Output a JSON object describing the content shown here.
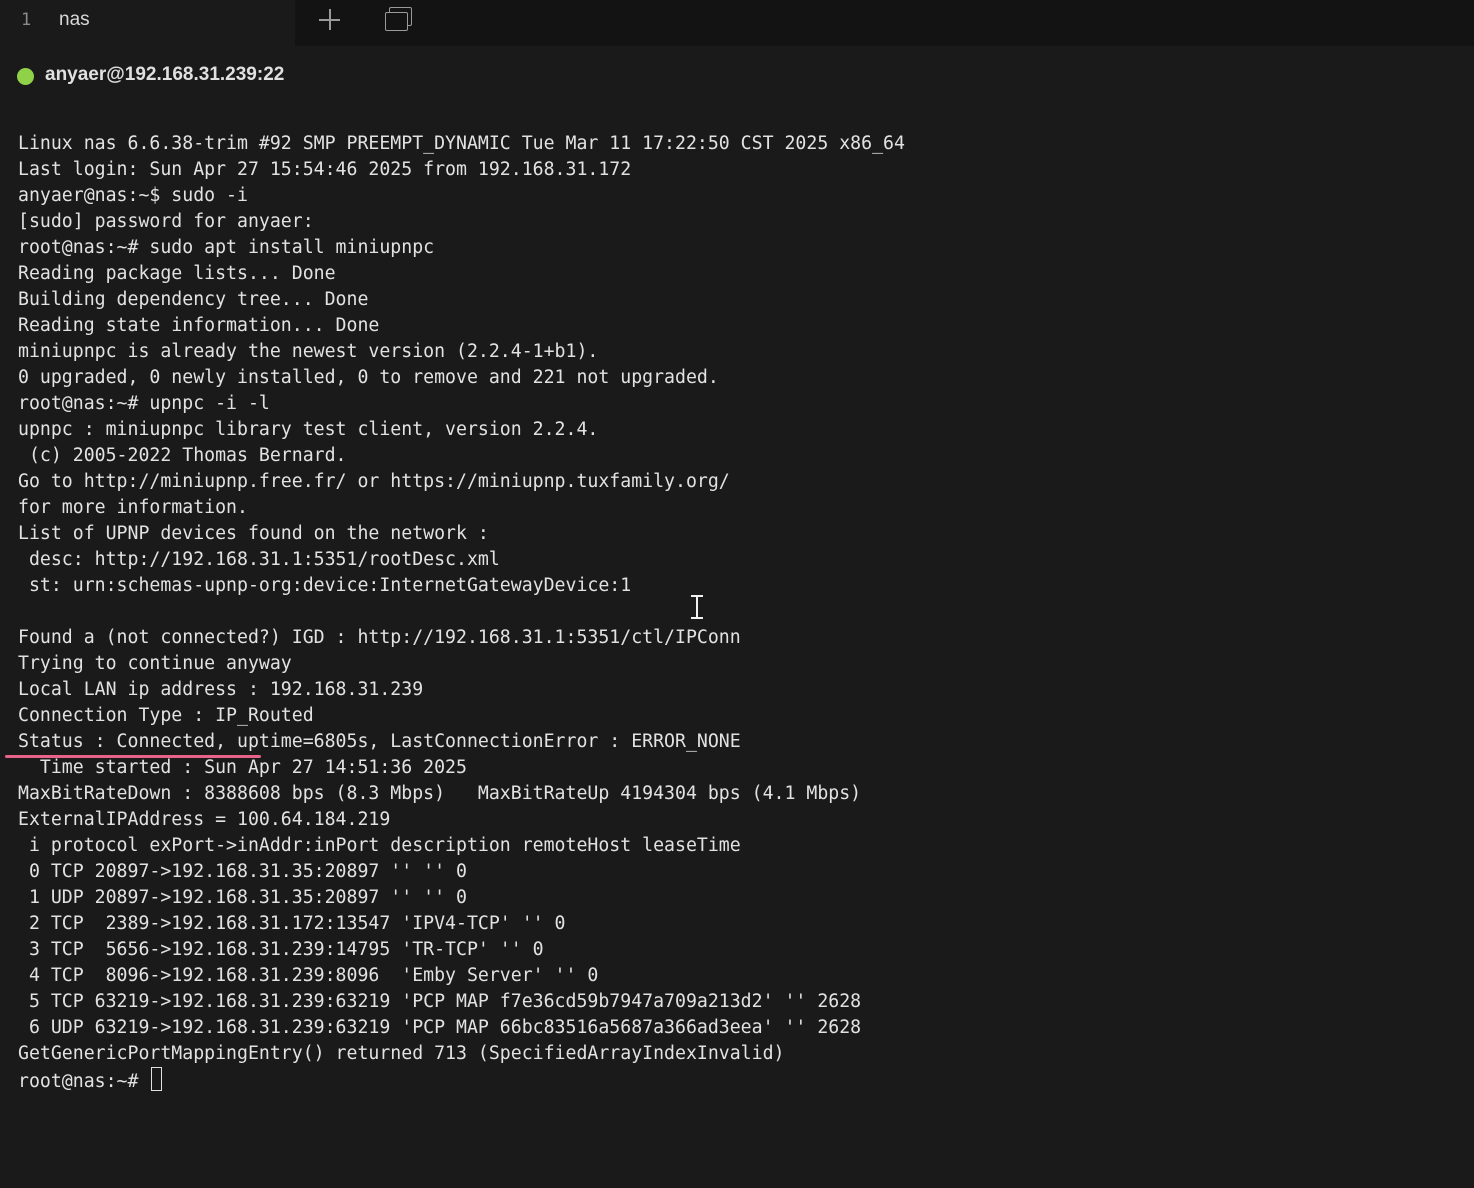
{
  "tabbar": {
    "tabs": [
      {
        "index": "1",
        "label": "nas"
      }
    ],
    "new_tab_icon": "plus-icon",
    "windows_icon": "windows-icon"
  },
  "session": {
    "status_color": "#8fd24a",
    "label": "anyaer@192.168.31.239:22"
  },
  "terminal": {
    "lines": [
      "Linux nas 6.6.38-trim #92 SMP PREEMPT_DYNAMIC Tue Mar 11 17:22:50 CST 2025 x86_64",
      "Last login: Sun Apr 27 15:54:46 2025 from 192.168.31.172",
      "anyaer@nas:~$ sudo -i",
      "[sudo] password for anyaer:",
      "root@nas:~# sudo apt install miniupnpc",
      "Reading package lists... Done",
      "Building dependency tree... Done",
      "Reading state information... Done",
      "miniupnpc is already the newest version (2.2.4-1+b1).",
      "0 upgraded, 0 newly installed, 0 to remove and 221 not upgraded.",
      "root@nas:~# upnpc -i -l",
      "upnpc : miniupnpc library test client, version 2.2.4.",
      " (c) 2005-2022 Thomas Bernard.",
      "Go to http://miniupnp.free.fr/ or https://miniupnp.tuxfamily.org/",
      "for more information.",
      "List of UPNP devices found on the network :",
      " desc: http://192.168.31.1:5351/rootDesc.xml",
      " st: urn:schemas-upnp-org:device:InternetGatewayDevice:1",
      "",
      "Found a (not connected?) IGD : http://192.168.31.1:5351/ctl/IPConn",
      "Trying to continue anyway",
      "Local LAN ip address : 192.168.31.239",
      "Connection Type : IP_Routed",
      "Status : Connected, uptime=6805s, LastConnectionError : ERROR_NONE",
      "  Time started : Sun Apr 27 14:51:36 2025",
      "MaxBitRateDown : 8388608 bps (8.3 Mbps)   MaxBitRateUp 4194304 bps (4.1 Mbps)",
      "ExternalIPAddress = 100.64.184.219",
      " i protocol exPort->inAddr:inPort description remoteHost leaseTime",
      " 0 TCP 20897->192.168.31.35:20897 '' '' 0",
      " 1 UDP 20897->192.168.31.35:20897 '' '' 0",
      " 2 TCP  2389->192.168.31.172:13547 'IPV4-TCP' '' 0",
      " 3 TCP  5656->192.168.31.239:14795 'TR-TCP' '' 0",
      " 4 TCP  8096->192.168.31.239:8096  'Emby Server' '' 0",
      " 5 TCP 63219->192.168.31.239:63219 'PCP MAP f7e36cd59b7947a709a213d2' '' 2628",
      " 6 UDP 63219->192.168.31.239:63219 'PCP MAP 66bc83516a5687a366ad3eea' '' 2628",
      "GetGenericPortMappingEntry() returned 713 (SpecifiedArrayIndexInvalid)"
    ],
    "prompt": "root@nas:~# ",
    "highlight_color": "#e8638a"
  }
}
